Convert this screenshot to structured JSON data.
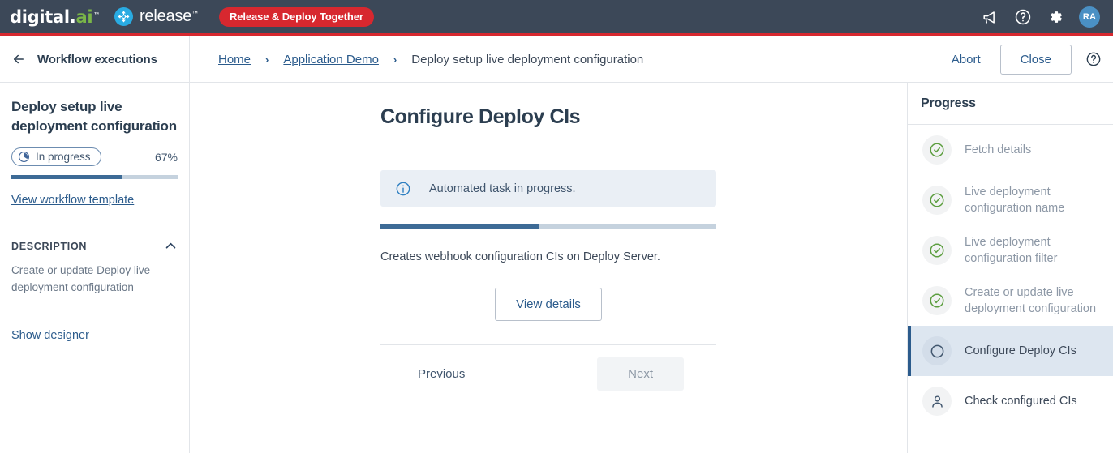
{
  "topbar": {
    "brand_primary": "digital.",
    "brand_ai": "ai",
    "brand_tm": "™",
    "product": "release",
    "product_tm": "™",
    "tagline_pill": "Release & Deploy Together",
    "icons": [
      {
        "name": "announcements-icon",
        "title": "Announcements"
      },
      {
        "name": "help-icon",
        "title": "Help"
      },
      {
        "name": "settings-gear-icon",
        "title": "Settings"
      }
    ],
    "avatar_initials": "RA",
    "colors": {
      "bar": "#3c4858",
      "stripe": "#d7282f",
      "accent_red": "#d7282f",
      "release_blue": "#29abe2",
      "avatar": "#4a90c4"
    }
  },
  "subbar": {
    "back_label": "Workflow executions",
    "breadcrumbs": [
      {
        "label": "Home",
        "is_link": true
      },
      {
        "label": "Application Demo",
        "is_link": true
      },
      {
        "label": "Deploy setup live deployment configuration",
        "is_link": false
      }
    ],
    "separator": "›",
    "abort_label": "Abort",
    "close_label": "Close",
    "help_icon": "help-icon"
  },
  "sidebar": {
    "title": "Deploy setup live deployment configuration",
    "status_label": "In progress",
    "status_icon": "clock-icon",
    "percent_label": "67%",
    "percent_value": 67,
    "workflow_template_link": "View workflow template",
    "description_heading": "DESCRIPTION",
    "collapse_icon": "chevron-up-icon",
    "description_body": "Create or update Deploy live deployment configuration",
    "show_designer_link": "Show designer"
  },
  "main": {
    "title": "Configure Deploy CIs",
    "info_icon": "info-circle-icon",
    "info_message": "Automated task in progress.",
    "task_progress_percent": 47,
    "task_description": "Creates webhook configuration CIs on Deploy Server.",
    "view_details_label": "View details",
    "previous_label": "Previous",
    "next_label": "Next"
  },
  "progress_panel": {
    "heading": "Progress",
    "items": [
      {
        "label": "Fetch details",
        "state": "done",
        "icon": "check-circle-icon"
      },
      {
        "label": "Live deployment configuration name",
        "state": "done",
        "icon": "check-circle-icon"
      },
      {
        "label": "Live deployment configuration filter",
        "state": "done",
        "icon": "check-circle-icon"
      },
      {
        "label": "Create or update live deployment configuration",
        "state": "done",
        "icon": "check-circle-icon"
      },
      {
        "label": "Configure Deploy CIs",
        "state": "active",
        "icon": "circle-outline-icon"
      },
      {
        "label": "Check configured CIs",
        "state": "pending",
        "icon": "person-icon"
      }
    ],
    "colors": {
      "done": "#5c9e3f",
      "active_bg": "#dde6f0",
      "active_bar": "#2b5b8c"
    }
  }
}
